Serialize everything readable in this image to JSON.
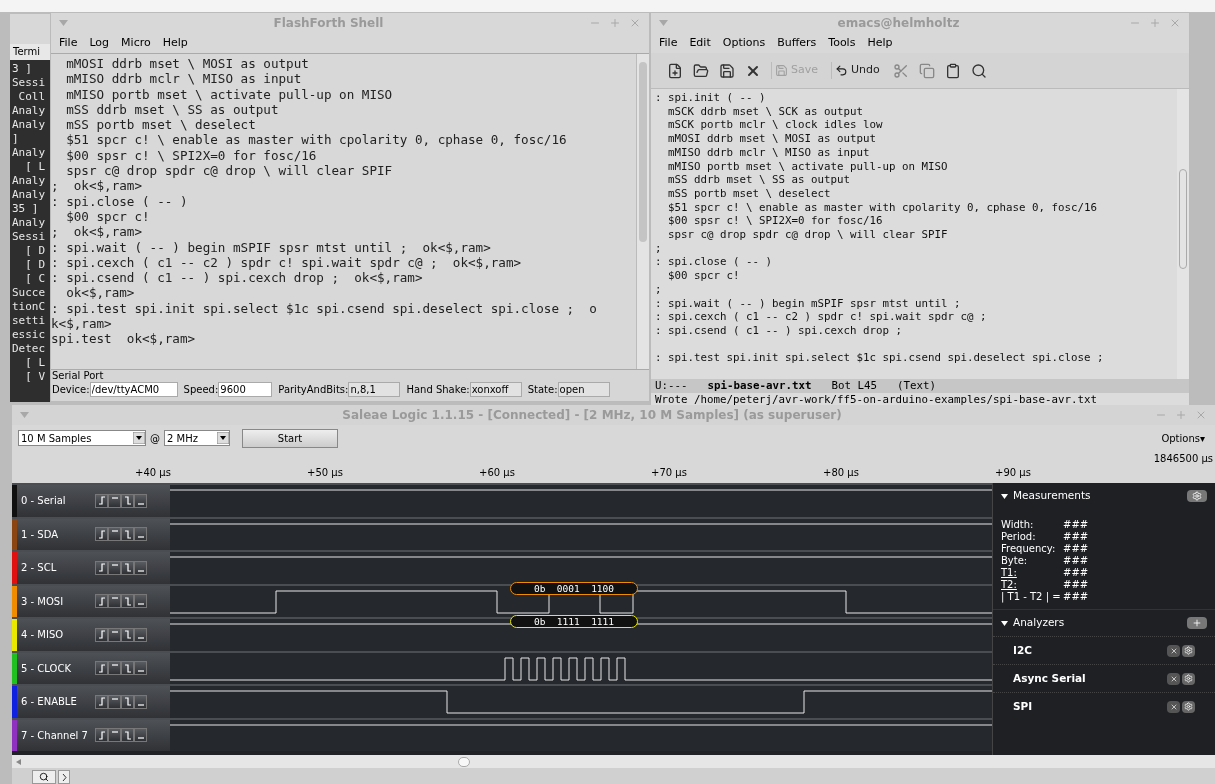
{
  "terminal_window": {
    "tab": "Termi",
    "lines": [
      "3 ]",
      "Sessi",
      " Coll",
      "Analy",
      "Analy",
      "]",
      "Analy",
      "  [ L",
      "Analy",
      "Analy",
      "35 ]",
      "Analy",
      "Sessi",
      "  [ D",
      "  [ D",
      "  [ C",
      "Succe",
      "tionC",
      "setti",
      "essic",
      "Detec",
      "  [ L",
      "  [ V"
    ]
  },
  "flashforth_window": {
    "title": "FlashForth Shell",
    "menu": [
      "File",
      "Log",
      "Micro",
      "Help"
    ],
    "lines": [
      "  mMOSI ddrb mset \\ MOSI as output",
      "  mMISO ddrb mclr \\ MISO as input",
      "  mMISO portb mset \\ activate pull-up on MISO",
      "  mSS ddrb mset \\ SS as output",
      "  mSS portb mset \\ deselect",
      "  $51 spcr c! \\ enable as master with cpolarity 0, cphase 0, fosc/16",
      "  $00 spsr c! \\ SPI2X=0 for fosc/16",
      "  spsr c@ drop spdr c@ drop \\ will clear SPIF",
      ";  ok<$,ram>",
      ": spi.close ( -- )",
      "  $00 spcr c!",
      ";  ok<$,ram>",
      ": spi.wait ( -- ) begin mSPIF spsr mtst until ;  ok<$,ram>",
      ": spi.cexch ( c1 -- c2 ) spdr c! spi.wait spdr c@ ;  ok<$,ram>",
      ": spi.csend ( c1 -- ) spi.cexch drop ;  ok<$,ram>",
      "  ok<$,ram>",
      ": spi.test spi.init spi.select $1c spi.csend spi.deselect spi.close ;  o",
      "k<$,ram>",
      "spi.test  ok<$,ram>"
    ],
    "serial_port": {
      "label": "Serial Port",
      "fields": [
        {
          "label": "Device:",
          "value": "/dev/ttyACM0"
        },
        {
          "label": "Speed:",
          "value": "9600"
        },
        {
          "label": "ParityAndBits:",
          "value": "n,8,1"
        },
        {
          "label": "Hand Shake:",
          "value": "xonxoff"
        },
        {
          "label": "State:",
          "value": "open"
        }
      ]
    }
  },
  "emacs_window": {
    "title": "emacs@helmholtz",
    "menu": [
      "File",
      "Edit",
      "Options",
      "Buffers",
      "Tools",
      "Help"
    ],
    "toolbar": [
      {
        "label": "Save",
        "disabled": true
      },
      {
        "label": "Undo",
        "disabled": false
      }
    ],
    "lines": [
      {
        "text": ": spi.init ( -- )"
      },
      {
        "text": "  mSCK ddrb mset \\ SCK as output"
      },
      {
        "text": "  mSCK portb mclr \\ clock idles low"
      },
      {
        "text": "  mMOSI ddrb mset \\ MOSI as output"
      },
      {
        "text": "  mMISO ddrb mclr \\ MISO as input"
      },
      {
        "text": "  mMISO portb mset \\ activate pull-up on MISO"
      },
      {
        "text": "  mSS ddrb mset \\ SS as output"
      },
      {
        "text": "  mSS portb mset \\ deselect"
      },
      {
        "text": "  $51 spcr c! \\ enable as master with cpolarity 0, cphase 0, fosc/16"
      },
      {
        "text": "  $00 spsr c! \\ SPI2X=0 for fosc/16"
      },
      {
        "text": "  spsr c@ drop spdr c@ drop \\ will clear SPIF"
      },
      {
        "text": ";"
      },
      {
        "text": ": spi.close ( -- )"
      },
      {
        "text": "  $00 spcr c!"
      },
      {
        "text": ";"
      },
      {
        "text": ": spi.wait ( -- ) begin mSPIF spsr mtst until ;"
      },
      {
        "text": ": spi.cexch ( c1 -- c2 ) spdr c! spi.wait spdr c@ ;"
      },
      {
        "text": ": spi.csend ( c1 -- ) spi.cexch drop ;"
      },
      {
        "text": ": spi.test spi.init spi.select $1c spi.csend spi.deselect spi.close ;",
        "blank_before": true
      }
    ],
    "mode_line": {
      "status": "U:---",
      "buffer": "spi-base-avr.txt",
      "position": "Bot L45",
      "mode": "(Text)"
    },
    "echo_area": "Wrote /home/peterj/avr-work/ff5-on-arduino-examples/spi-base-avr.txt"
  },
  "saleae_window": {
    "title": "Saleae Logic 1.1.15 - [Connected] - [2 MHz, 10 M Samples] (as superuser)",
    "samples": "10 M Samples",
    "at": "@",
    "rate": "2 MHz",
    "start_button": "Start",
    "options": "Options▾",
    "ruler": [
      "+40 µs",
      "+50 µs",
      "+60 µs",
      "+70 µs",
      "+80 µs",
      "+90 µs"
    ],
    "time_readout": "1846500 µs",
    "channels": [
      {
        "name": "0 - Serial",
        "color": "#101010",
        "kind": "idle"
      },
      {
        "name": "1 - SDA",
        "color": "#8b4513",
        "kind": "idle"
      },
      {
        "name": "2 - SCL",
        "color": "#e01010",
        "kind": "idle"
      },
      {
        "name": "3 - MOSI",
        "color": "#f08c00",
        "kind": "data",
        "decode": "0b  0001  1100"
      },
      {
        "name": "4 - MISO",
        "color": "#e8e800",
        "kind": "idle",
        "decode": "0b  1111  1111"
      },
      {
        "name": "5 - CLOCK",
        "color": "#20c020",
        "kind": "clock"
      },
      {
        "name": "6 - ENABLE",
        "color": "#1020e0",
        "kind": "select"
      },
      {
        "name": "7 - Channel 7",
        "color": "#9030c0",
        "kind": "idle"
      }
    ],
    "measurements": {
      "title": "Measurements",
      "expanded": true,
      "rows": [
        {
          "label": "Width:",
          "value": "###"
        },
        {
          "label": "Period:",
          "value": "###"
        },
        {
          "label": "Frequency:",
          "value": "###"
        },
        {
          "label": "Byte:",
          "value": "###"
        },
        {
          "label": "T1:",
          "value": "###",
          "underline": true
        },
        {
          "label": "T2:",
          "value": "###",
          "underline": true
        },
        {
          "label": "| T1 - T2 | =",
          "value": "###"
        }
      ]
    },
    "analyzers": {
      "title": "Analyzers",
      "expanded": true,
      "items": [
        "I2C",
        "Async Serial",
        "SPI"
      ]
    }
  }
}
